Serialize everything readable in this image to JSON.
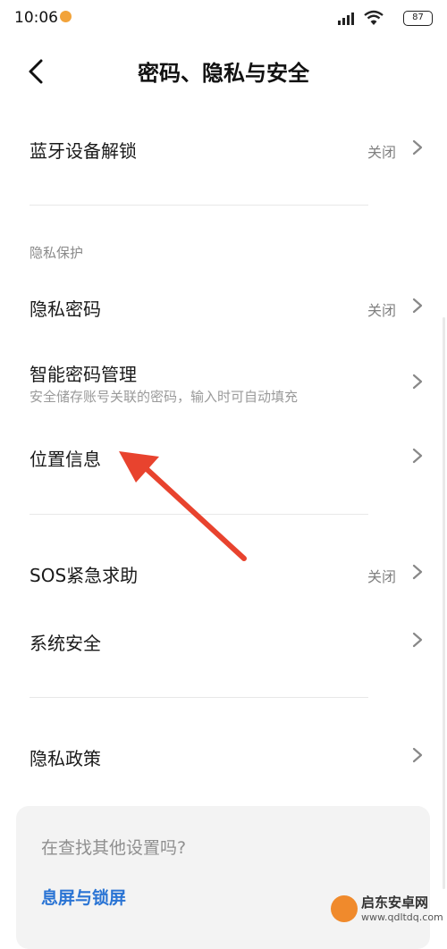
{
  "status_bar": {
    "time": "10:06",
    "battery": "87"
  },
  "header": {
    "title": "密码、隐私与安全"
  },
  "rows": {
    "bluetooth_unlock": {
      "title": "蓝牙设备解锁",
      "value": "关闭"
    },
    "privacy_password": {
      "title": "隐私密码",
      "value": "关闭"
    },
    "smart_password": {
      "title": "智能密码管理",
      "subtitle": "安全储存账号关联的密码，输入时可自动填充"
    },
    "location": {
      "title": "位置信息"
    },
    "sos": {
      "title": "SOS紧急求助",
      "value": "关闭"
    },
    "system_security": {
      "title": "系统安全"
    },
    "privacy_policy": {
      "title": "隐私政策"
    }
  },
  "sections": {
    "privacy_label": "隐私保护"
  },
  "search_card": {
    "prompt": "在查找其他设置吗?",
    "link": "息屏与锁屏"
  },
  "watermark": {
    "name": "启东安卓网",
    "url": "www.qdltdq.com"
  },
  "colors": {
    "accent": "#2a74d4",
    "arrow": "#e8432e",
    "card_bg": "#f3f3f3"
  }
}
